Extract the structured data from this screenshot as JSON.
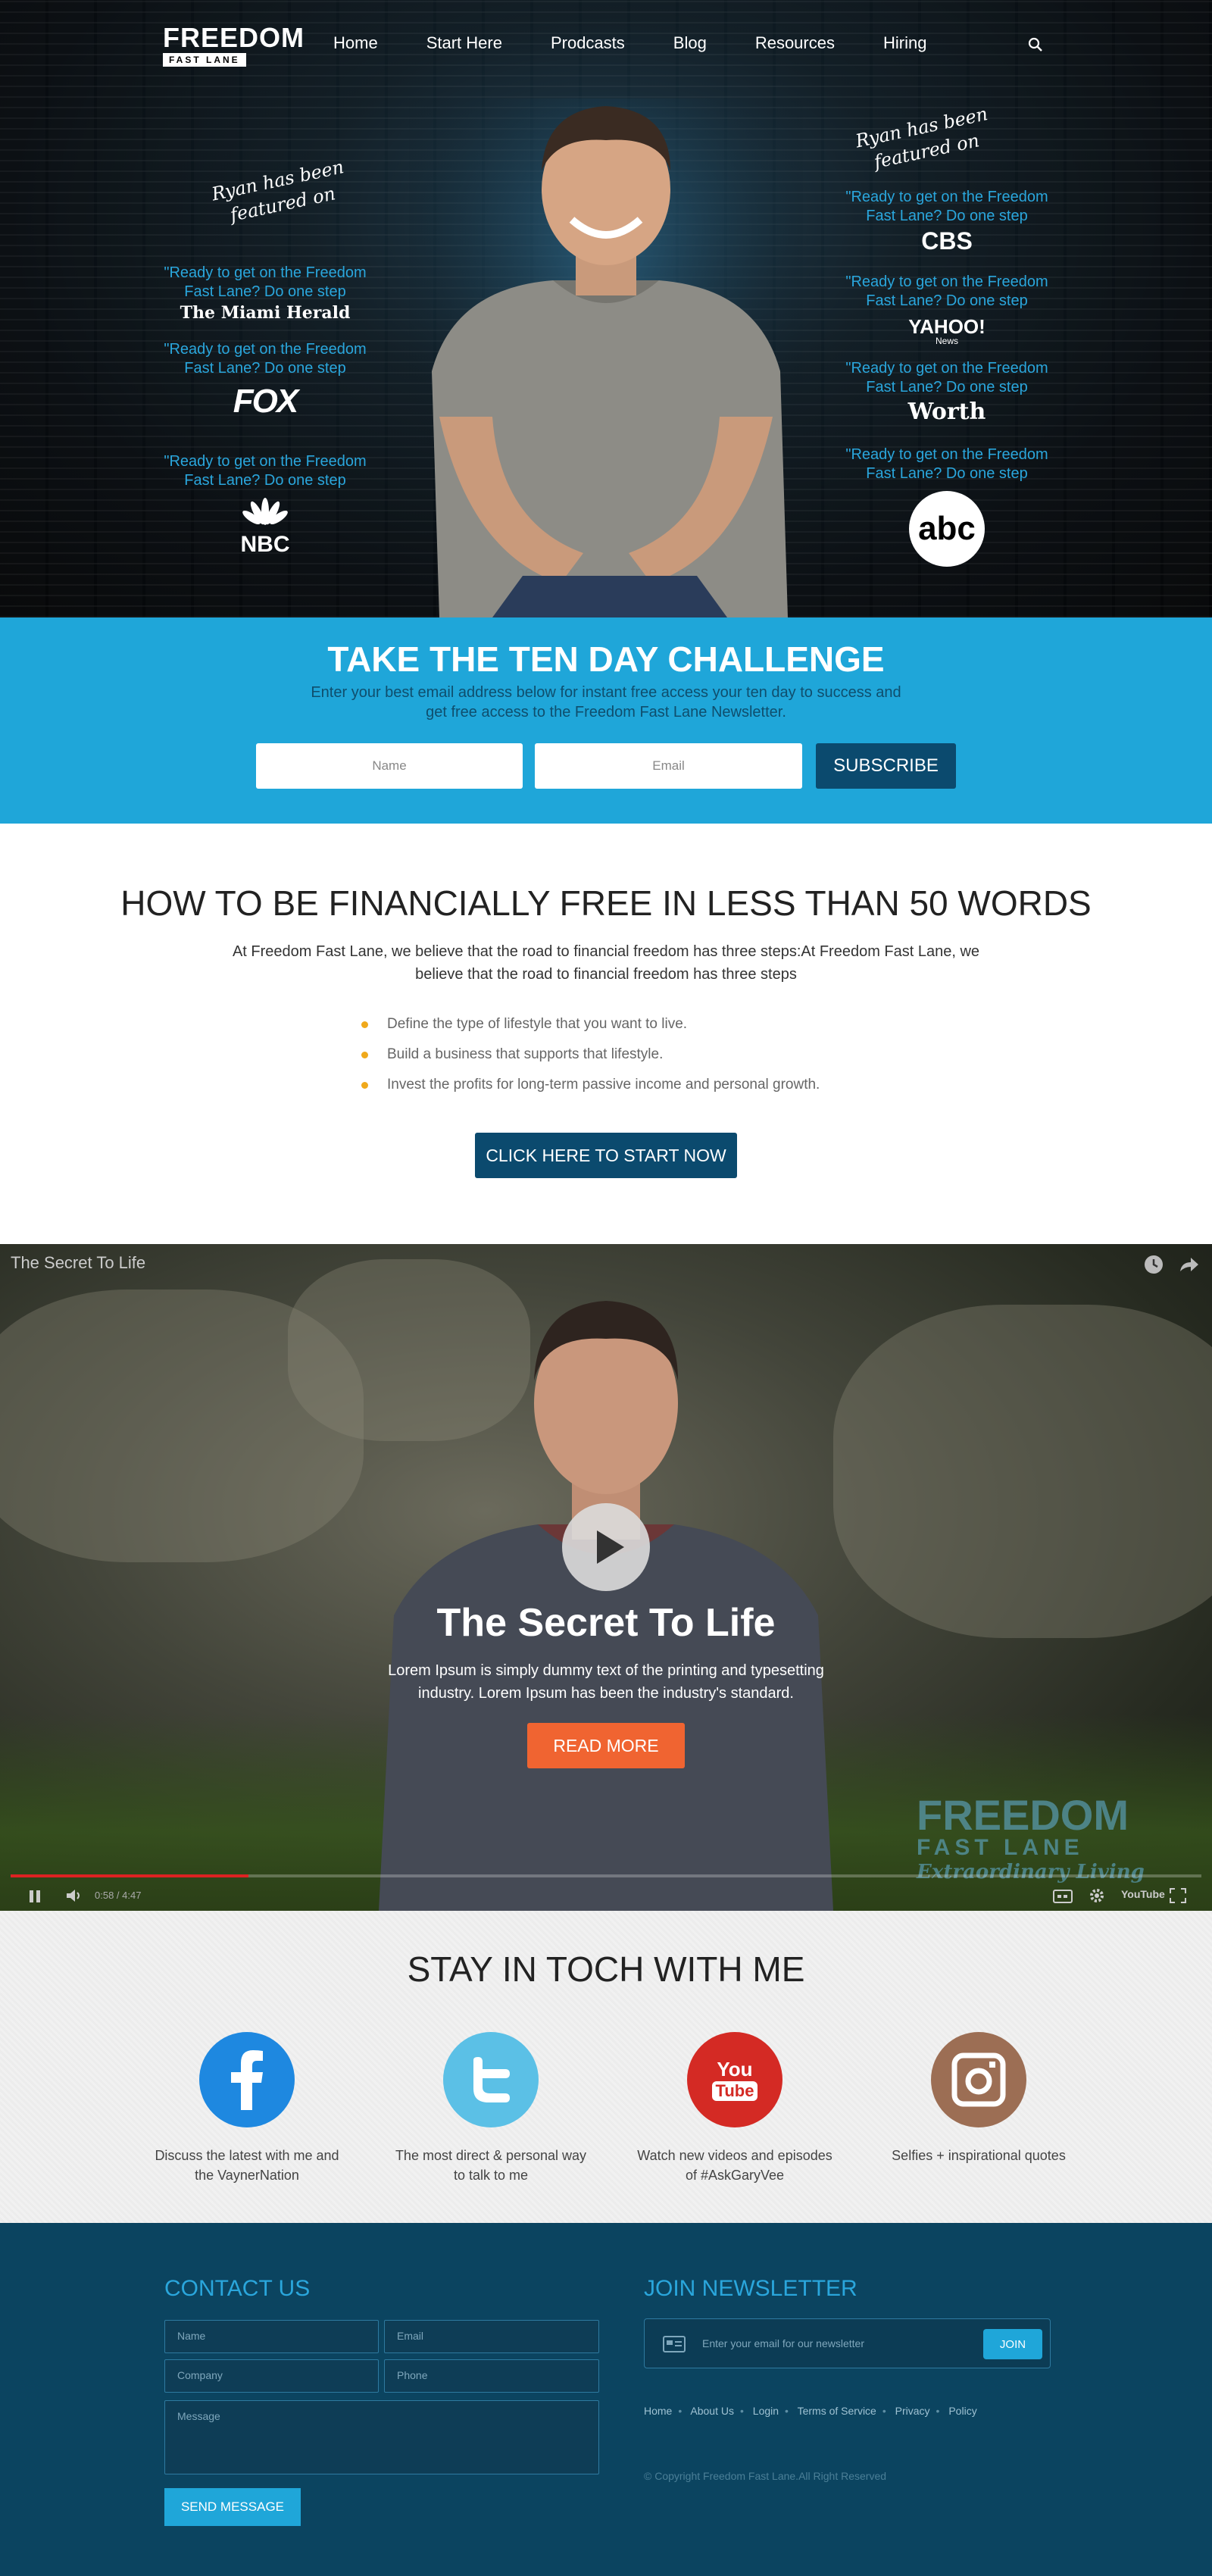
{
  "header": {
    "logo_big": "FREEDOM",
    "logo_small": "FAST LANE",
    "nav": [
      "Home",
      "Start Here",
      "Prodcasts",
      "Blog",
      "Resources",
      "Hiring"
    ]
  },
  "hero": {
    "featured_left": "Ryan has been featured on",
    "featured_right": "Ryan has been featured on",
    "quote": "\"Ready to get on the Freedom Fast Lane? Do one step",
    "left_logos": [
      "The Miami Herald",
      "FOX",
      "NBC"
    ],
    "right_logos": [
      "CBS",
      "YAHOO!",
      "Worth",
      "abc"
    ],
    "yahoo_sub": "News"
  },
  "challenge": {
    "title": "TAKE THE TEN DAY CHALLENGE",
    "text": "Enter your best email address below for instant free access your ten day to success and get free access to the Freedom Fast Lane Newsletter.",
    "name_placeholder": "Name",
    "email_placeholder": "Email",
    "button": "SUBSCRIBE"
  },
  "financial": {
    "title": "HOW TO BE FINANCIALLY FREE IN LESS THAN 50 WORDS",
    "lead": "At Freedom Fast Lane, we believe that the road to financial freedom has three steps:At Freedom Fast Lane, we believe that the road to financial freedom has three steps",
    "steps": [
      "Define the type of lifestyle that you want to live.",
      "Build a business that supports that lifestyle.",
      "Invest the profits for long-term passive income and personal growth."
    ],
    "button": "CLICK HERE TO START NOW"
  },
  "video": {
    "top_title": "The Secret To Life",
    "title": "The Secret To Life",
    "text": "Lorem Ipsum is simply dummy text of the printing and typesetting industry. Lorem Ipsum has  been the industry's standard.",
    "button": "READ MORE",
    "watermark_big": "FREEDOM",
    "watermark_small": "FAST LANE",
    "watermark_tag": "Extraordinary Living",
    "time": "0:58 / 4:47",
    "progress": 0.2,
    "youtube": "YouTube"
  },
  "social": {
    "title": "STAY IN TOCH WITH ME",
    "items": [
      {
        "text": "Discuss the latest with me and the VaynerNation",
        "color": "#1e88e0"
      },
      {
        "text": "The most direct & personal way to talk to me",
        "color": "#5bc0e6"
      },
      {
        "text": "Watch new videos and episodes of #AskGaryVee",
        "color": "#d42a24"
      },
      {
        "text": "Selfies + inspirational quotes",
        "color": "#9c6e54"
      }
    ],
    "youtube_you": "You",
    "youtube_tube": "Tube"
  },
  "footer": {
    "contact_title": "CONTACT US",
    "newsletter_title": "JOIN NEWSLETTER",
    "name": "Name",
    "email": "Email",
    "company": "Company",
    "phone": "Phone",
    "message": "Message",
    "send": "SEND MESSAGE",
    "newsletter_placeholder": "Enter your email for our newsletter",
    "join": "JOIN",
    "links": [
      "Home",
      "About Us",
      "Login",
      "Terms of Service",
      "Privacy",
      "Policy"
    ],
    "copyright": "© Copyright Freedom Fast Lane.All Right Reserved"
  }
}
